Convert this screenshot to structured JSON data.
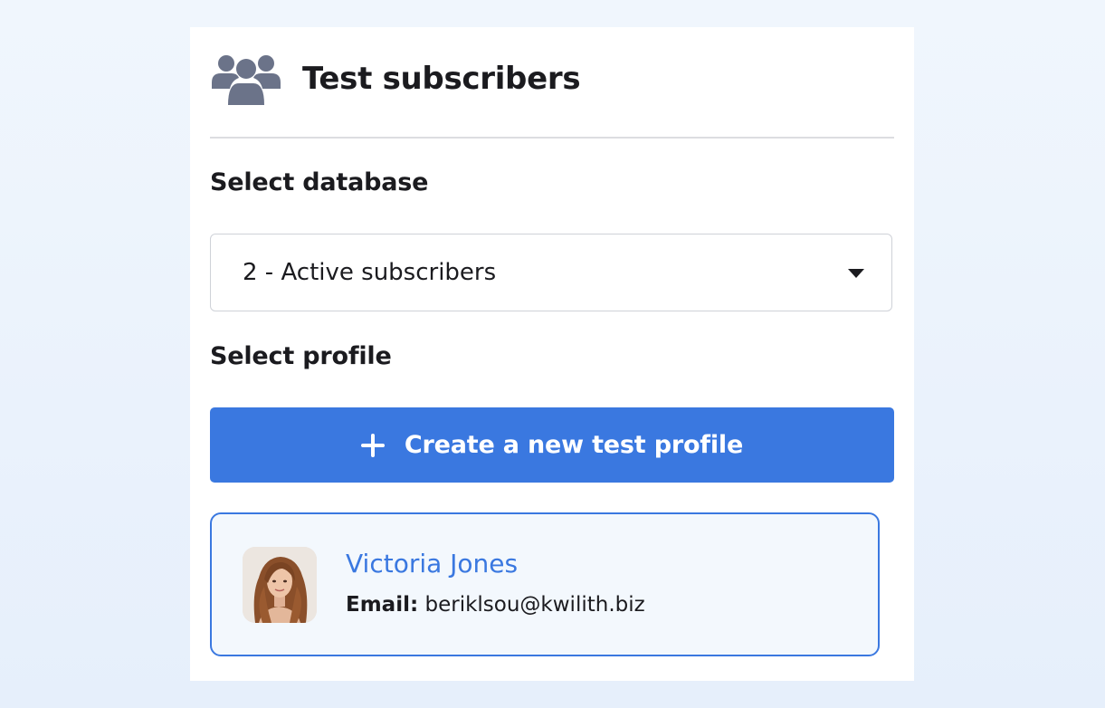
{
  "panel": {
    "title": "Test subscribers",
    "header_icon": "users-group-icon"
  },
  "database": {
    "label": "Select database",
    "selected": "2 - Active subscribers"
  },
  "profile": {
    "label": "Select profile",
    "create_button_label": "Create a new test profile",
    "create_button_icon": "plus-icon",
    "cards": [
      {
        "name": "Victoria Jones",
        "email_label": "Email:",
        "email": "beriklsou@kwilith.biz"
      }
    ]
  },
  "colors": {
    "accent": "#3a78e0",
    "icon_gray": "#6b7389",
    "card_bg": "#f3f8fd"
  }
}
